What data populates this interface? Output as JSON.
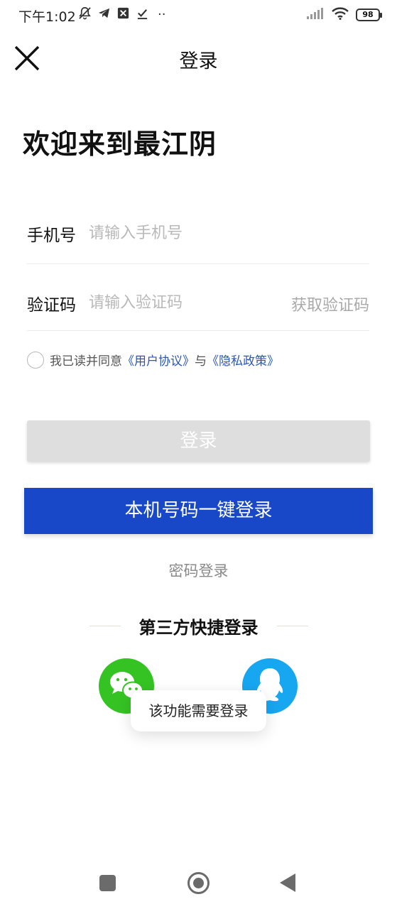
{
  "status_bar": {
    "time": "下午1:02",
    "battery": "98",
    "more": "··"
  },
  "header": {
    "title": "登录"
  },
  "welcome": "欢迎来到最江阴",
  "form": {
    "phone": {
      "label": "手机号",
      "placeholder": "请输入手机号"
    },
    "code": {
      "label": "验证码",
      "placeholder": "请输入验证码",
      "get_code": "获取验证码"
    }
  },
  "agreement": {
    "prefix": "我已读并同意",
    "user_agreement": "《用户协议》",
    "and": "与",
    "privacy_policy": "《隐私政策》"
  },
  "buttons": {
    "login": "登录",
    "one_key_login": "本机号码一键登录",
    "password_login": "密码登录"
  },
  "third_party": {
    "title": "第三方快捷登录"
  },
  "toast": "该功能需要登录",
  "colors": {
    "primary_blue": "#1848c7",
    "link_blue": "#2a56b8",
    "wechat_green": "#35c324",
    "qq_blue": "#17a6f0",
    "disabled_gray": "#dedede"
  }
}
